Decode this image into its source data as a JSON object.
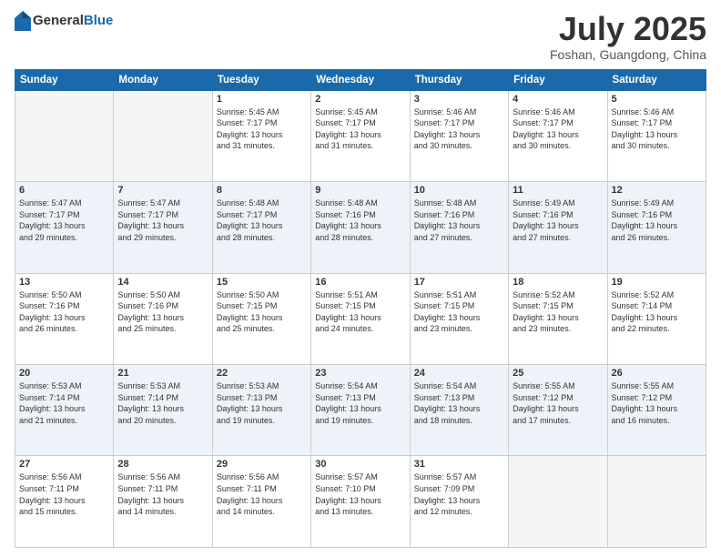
{
  "header": {
    "logo_general": "General",
    "logo_blue": "Blue",
    "month": "July 2025",
    "location": "Foshan, Guangdong, China"
  },
  "weekdays": [
    "Sunday",
    "Monday",
    "Tuesday",
    "Wednesday",
    "Thursday",
    "Friday",
    "Saturday"
  ],
  "weeks": [
    [
      {
        "day": "",
        "info": ""
      },
      {
        "day": "",
        "info": ""
      },
      {
        "day": "1",
        "info": "Sunrise: 5:45 AM\nSunset: 7:17 PM\nDaylight: 13 hours\nand 31 minutes."
      },
      {
        "day": "2",
        "info": "Sunrise: 5:45 AM\nSunset: 7:17 PM\nDaylight: 13 hours\nand 31 minutes."
      },
      {
        "day": "3",
        "info": "Sunrise: 5:46 AM\nSunset: 7:17 PM\nDaylight: 13 hours\nand 30 minutes."
      },
      {
        "day": "4",
        "info": "Sunrise: 5:46 AM\nSunset: 7:17 PM\nDaylight: 13 hours\nand 30 minutes."
      },
      {
        "day": "5",
        "info": "Sunrise: 5:46 AM\nSunset: 7:17 PM\nDaylight: 13 hours\nand 30 minutes."
      }
    ],
    [
      {
        "day": "6",
        "info": "Sunrise: 5:47 AM\nSunset: 7:17 PM\nDaylight: 13 hours\nand 29 minutes."
      },
      {
        "day": "7",
        "info": "Sunrise: 5:47 AM\nSunset: 7:17 PM\nDaylight: 13 hours\nand 29 minutes."
      },
      {
        "day": "8",
        "info": "Sunrise: 5:48 AM\nSunset: 7:17 PM\nDaylight: 13 hours\nand 28 minutes."
      },
      {
        "day": "9",
        "info": "Sunrise: 5:48 AM\nSunset: 7:16 PM\nDaylight: 13 hours\nand 28 minutes."
      },
      {
        "day": "10",
        "info": "Sunrise: 5:48 AM\nSunset: 7:16 PM\nDaylight: 13 hours\nand 27 minutes."
      },
      {
        "day": "11",
        "info": "Sunrise: 5:49 AM\nSunset: 7:16 PM\nDaylight: 13 hours\nand 27 minutes."
      },
      {
        "day": "12",
        "info": "Sunrise: 5:49 AM\nSunset: 7:16 PM\nDaylight: 13 hours\nand 26 minutes."
      }
    ],
    [
      {
        "day": "13",
        "info": "Sunrise: 5:50 AM\nSunset: 7:16 PM\nDaylight: 13 hours\nand 26 minutes."
      },
      {
        "day": "14",
        "info": "Sunrise: 5:50 AM\nSunset: 7:16 PM\nDaylight: 13 hours\nand 25 minutes."
      },
      {
        "day": "15",
        "info": "Sunrise: 5:50 AM\nSunset: 7:15 PM\nDaylight: 13 hours\nand 25 minutes."
      },
      {
        "day": "16",
        "info": "Sunrise: 5:51 AM\nSunset: 7:15 PM\nDaylight: 13 hours\nand 24 minutes."
      },
      {
        "day": "17",
        "info": "Sunrise: 5:51 AM\nSunset: 7:15 PM\nDaylight: 13 hours\nand 23 minutes."
      },
      {
        "day": "18",
        "info": "Sunrise: 5:52 AM\nSunset: 7:15 PM\nDaylight: 13 hours\nand 23 minutes."
      },
      {
        "day": "19",
        "info": "Sunrise: 5:52 AM\nSunset: 7:14 PM\nDaylight: 13 hours\nand 22 minutes."
      }
    ],
    [
      {
        "day": "20",
        "info": "Sunrise: 5:53 AM\nSunset: 7:14 PM\nDaylight: 13 hours\nand 21 minutes."
      },
      {
        "day": "21",
        "info": "Sunrise: 5:53 AM\nSunset: 7:14 PM\nDaylight: 13 hours\nand 20 minutes."
      },
      {
        "day": "22",
        "info": "Sunrise: 5:53 AM\nSunset: 7:13 PM\nDaylight: 13 hours\nand 19 minutes."
      },
      {
        "day": "23",
        "info": "Sunrise: 5:54 AM\nSunset: 7:13 PM\nDaylight: 13 hours\nand 19 minutes."
      },
      {
        "day": "24",
        "info": "Sunrise: 5:54 AM\nSunset: 7:13 PM\nDaylight: 13 hours\nand 18 minutes."
      },
      {
        "day": "25",
        "info": "Sunrise: 5:55 AM\nSunset: 7:12 PM\nDaylight: 13 hours\nand 17 minutes."
      },
      {
        "day": "26",
        "info": "Sunrise: 5:55 AM\nSunset: 7:12 PM\nDaylight: 13 hours\nand 16 minutes."
      }
    ],
    [
      {
        "day": "27",
        "info": "Sunrise: 5:56 AM\nSunset: 7:11 PM\nDaylight: 13 hours\nand 15 minutes."
      },
      {
        "day": "28",
        "info": "Sunrise: 5:56 AM\nSunset: 7:11 PM\nDaylight: 13 hours\nand 14 minutes."
      },
      {
        "day": "29",
        "info": "Sunrise: 5:56 AM\nSunset: 7:11 PM\nDaylight: 13 hours\nand 14 minutes."
      },
      {
        "day": "30",
        "info": "Sunrise: 5:57 AM\nSunset: 7:10 PM\nDaylight: 13 hours\nand 13 minutes."
      },
      {
        "day": "31",
        "info": "Sunrise: 5:57 AM\nSunset: 7:09 PM\nDaylight: 13 hours\nand 12 minutes."
      },
      {
        "day": "",
        "info": ""
      },
      {
        "day": "",
        "info": ""
      }
    ]
  ]
}
